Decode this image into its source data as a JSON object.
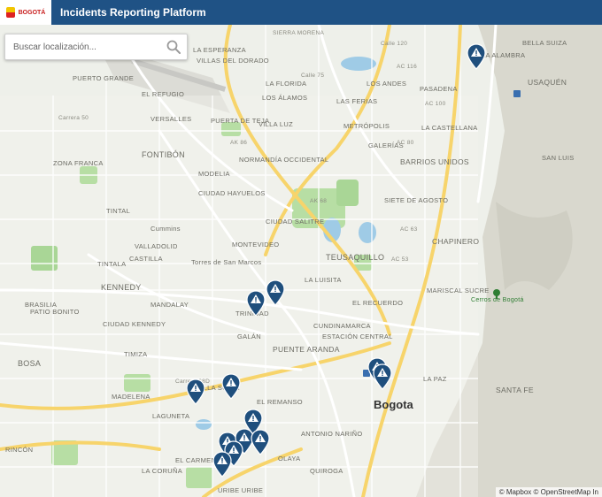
{
  "header": {
    "title": "Incidents Reporting Platform",
    "logo_text": "BOGOTÁ"
  },
  "search": {
    "placeholder": "Buscar localización..."
  },
  "map": {
    "attribution": "© Mapbox © OpenStreetMap In",
    "labels": [
      {
        "text": "SIERRA MORENA",
        "cls": "road"
      },
      {
        "text": "LA ESPERANZA",
        "cls": "nb"
      },
      {
        "text": "VILLAS DEL DORADO",
        "cls": "nb"
      },
      {
        "text": "EL REFUGIO",
        "cls": "nb"
      },
      {
        "text": "VERSALLES",
        "cls": "nb"
      },
      {
        "text": "FONTIBÓN",
        "cls": "nb"
      },
      {
        "text": "PUERTO GRANDE",
        "cls": "nb"
      },
      {
        "text": "ZONA FRANCA",
        "cls": "nb"
      },
      {
        "text": "MODELIA",
        "cls": "nb"
      },
      {
        "text": "TINTAL",
        "cls": "nb"
      },
      {
        "text": "CIUDAD HAYUELOS",
        "cls": "nb"
      },
      {
        "text": "Cummins",
        "cls": "nb"
      },
      {
        "text": "VALLADOLID",
        "cls": "nb"
      },
      {
        "text": "CASTILLA",
        "cls": "nb"
      },
      {
        "text": "TINTALA",
        "cls": "nb"
      },
      {
        "text": "KENNEDY",
        "cls": "nb"
      },
      {
        "text": "MANDALAY",
        "cls": "nb"
      },
      {
        "text": "BRASILIA",
        "cls": "nb"
      },
      {
        "text": "PATIO BONITO",
        "cls": "nb"
      },
      {
        "text": "CIUDAD KENNEDY",
        "cls": "nb"
      },
      {
        "text": "BOSA",
        "cls": "nb"
      },
      {
        "text": "TIMIZA",
        "cls": "nb"
      },
      {
        "text": "VILLA SONIA",
        "cls": "nb"
      },
      {
        "text": "MADELENA",
        "cls": "nb"
      },
      {
        "text": "LAGUNETA",
        "cls": "nb"
      },
      {
        "text": "EL REMANSO",
        "cls": "nb"
      },
      {
        "text": "EL CARMEN",
        "cls": "nb"
      },
      {
        "text": "LA CORUÑA",
        "cls": "nb"
      },
      {
        "text": "LOS ÁLAMOS",
        "cls": "nb"
      },
      {
        "text": "LA FLORIDA",
        "cls": "nb"
      },
      {
        "text": "VILLA LUZ",
        "cls": "nb"
      },
      {
        "text": "NORMANDÍA OCCIDENTAL",
        "cls": "nb"
      },
      {
        "text": "PUERTA DE TEJA",
        "cls": "nb"
      },
      {
        "text": "CIUDAD SALITRE",
        "cls": "nb"
      },
      {
        "text": "MONTEVIDEO",
        "cls": "nb"
      },
      {
        "text": "Torres de San Marcos",
        "cls": "nb"
      },
      {
        "text": "TEUSAQUILLO",
        "cls": "nb"
      },
      {
        "text": "LA LUISITA",
        "cls": "nb"
      },
      {
        "text": "TRINIDAD",
        "cls": "nb"
      },
      {
        "text": "GALÁN",
        "cls": "nb"
      },
      {
        "text": "PUENTE ARANDA",
        "cls": "nb"
      },
      {
        "text": "CUNDINAMARCA",
        "cls": "nb"
      },
      {
        "text": "ESTACIÓN CENTRAL",
        "cls": "nb"
      },
      {
        "text": "ANTONIO NARIÑO",
        "cls": "nb"
      },
      {
        "text": "OLAYA",
        "cls": "nb"
      },
      {
        "text": "QUIROGA",
        "cls": "nb"
      },
      {
        "text": "BARRIOS UNIDOS",
        "cls": "nb"
      },
      {
        "text": "METRÓPOLIS",
        "cls": "nb"
      },
      {
        "text": "LAS FERIAS",
        "cls": "nb"
      },
      {
        "text": "LOS ANDES",
        "cls": "nb"
      },
      {
        "text": "PASADENA",
        "cls": "nb"
      },
      {
        "text": "LA CASTELLANA",
        "cls": "nb"
      },
      {
        "text": "SIETE DE AGOSTO",
        "cls": "nb"
      },
      {
        "text": "CHAPINERO",
        "cls": "nb"
      },
      {
        "text": "USAQUÉN",
        "cls": "nb"
      },
      {
        "text": "BELLA SUIZA",
        "cls": "nb"
      },
      {
        "text": "LA ALAMBRA",
        "cls": "nb"
      },
      {
        "text": "SAN LUIS",
        "cls": "nb"
      },
      {
        "text": "MARISCAL SUCRE",
        "cls": "nb"
      },
      {
        "text": "Cerros de Bogotá",
        "cls": "park"
      },
      {
        "text": "SANTA FE",
        "cls": "nb"
      },
      {
        "text": "LA PAZ",
        "cls": "nb"
      },
      {
        "text": "EL RECUERDO",
        "cls": "nb"
      },
      {
        "text": "URIBE URIBE",
        "cls": "nb"
      },
      {
        "text": "RINCÓN",
        "cls": "nb"
      },
      {
        "text": "GALERÍAS",
        "cls": "nb"
      },
      {
        "text": "Bogota",
        "cls": "big"
      },
      {
        "text": "AC 116",
        "cls": "road"
      },
      {
        "text": "AC 100",
        "cls": "road"
      },
      {
        "text": "AC 80",
        "cls": "road"
      },
      {
        "text": "AC 63",
        "cls": "road"
      },
      {
        "text": "AC 53",
        "cls": "road"
      },
      {
        "text": "AK 68",
        "cls": "road"
      },
      {
        "text": "AK 86",
        "cls": "road"
      },
      {
        "text": "Calle 120",
        "cls": "road"
      },
      {
        "text": "Carrera 50",
        "cls": "road"
      },
      {
        "text": "Calle 75",
        "cls": "road"
      },
      {
        "text": "Carrera 68D",
        "cls": "road"
      }
    ]
  }
}
